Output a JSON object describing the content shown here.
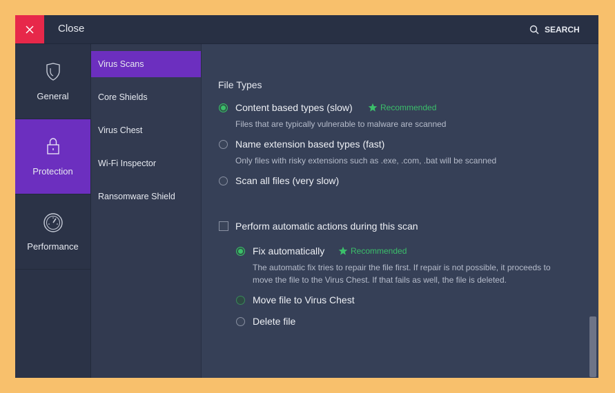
{
  "topbar": {
    "close_label": "Close",
    "search_label": "SEARCH"
  },
  "nav_primary": [
    {
      "label": "General",
      "icon": "shield-icon",
      "active": false
    },
    {
      "label": "Protection",
      "icon": "lock-icon",
      "active": true
    },
    {
      "label": "Performance",
      "icon": "speedometer-icon",
      "active": false
    }
  ],
  "nav_secondary": [
    {
      "label": "Virus Scans",
      "active": true
    },
    {
      "label": "Core Shields",
      "active": false
    },
    {
      "label": "Virus Chest",
      "active": false
    },
    {
      "label": "Wi-Fi Inspector",
      "active": false
    },
    {
      "label": "Ransomware Shield",
      "active": false
    }
  ],
  "file_types": {
    "title": "File Types",
    "options": [
      {
        "label": "Content based types (slow)",
        "selected": true,
        "recommended": "Recommended",
        "description": "Files that are typically vulnerable to malware are scanned"
      },
      {
        "label": "Name extension based types (fast)",
        "selected": false,
        "description": "Only files with risky extensions such as .exe, .com, .bat will be scanned"
      },
      {
        "label": "Scan all files (very slow)",
        "selected": false
      }
    ]
  },
  "auto_actions": {
    "label": "Perform automatic actions during this scan",
    "checked": false,
    "options": [
      {
        "label": "Fix automatically",
        "selected": true,
        "recommended": "Recommended",
        "description_line1": "The automatic fix tries to repair the file first. If repair is not possible, it proceeds to",
        "description_line2": "move the file to the Virus Chest. If that fails as well, the file is deleted."
      },
      {
        "label": "Move file to Virus Chest",
        "selected": false
      },
      {
        "label": "Delete file",
        "selected": false
      }
    ]
  },
  "colors": {
    "accent_purple": "#6c2fbf",
    "close_red": "#e7284a",
    "recommended_green": "#3bbf6a",
    "background": "#f8c06c"
  }
}
